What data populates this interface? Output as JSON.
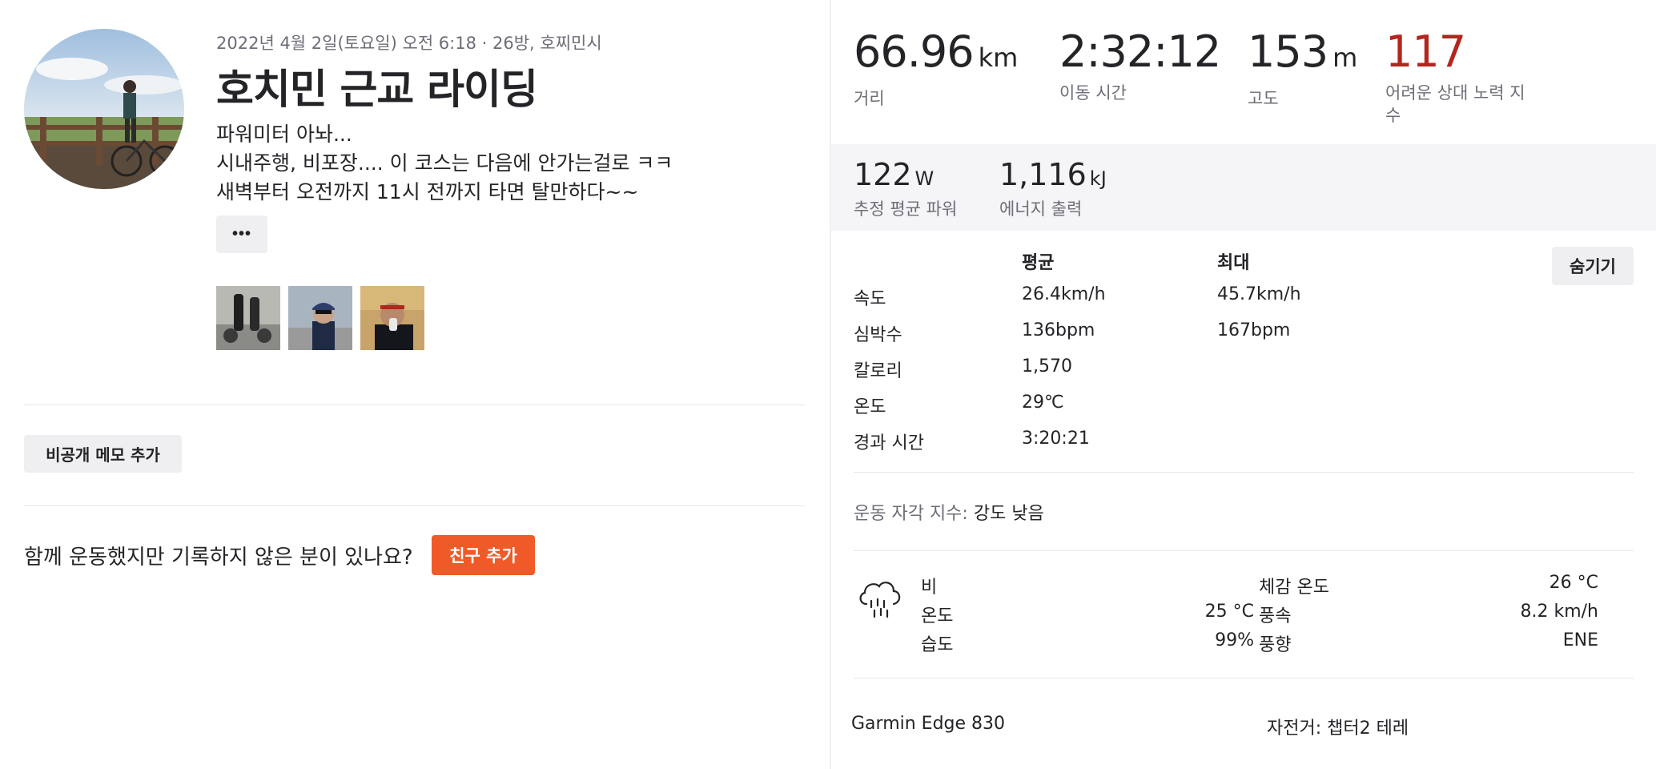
{
  "activity": {
    "meta": "2022년 4월 2일(토요일) 오전 6:18 · 26방, 호찌민시",
    "title": "호치민 근교 라이딩",
    "description": [
      "파워미터 아놔...",
      "시내주행, 비포장.... 이 코스는 다음에 안가는걸로 ㅋㅋ",
      "새벽부터 오전까지 11시 전까지 타면 탈만하다~~"
    ],
    "more_label": "•••",
    "photo_count": 3
  },
  "memo_button": "비공개 메모 추가",
  "invite": {
    "text": "함께 운동했지만 기록하지 않은 분이 있나요?",
    "button": "친구 추가"
  },
  "stats": [
    {
      "value": "66.96",
      "unit": "km",
      "label": "거리"
    },
    {
      "value": "2:32:12",
      "unit": "",
      "label": "이동 시간"
    },
    {
      "value": "153",
      "unit": "m",
      "label": "고도"
    },
    {
      "value": "117",
      "unit": "",
      "label": "어려운 상대 노력 지",
      "label2": "수"
    }
  ],
  "power": [
    {
      "value": "122",
      "unit": "W",
      "label": "추정 평균 파워"
    },
    {
      "value": "1,116",
      "unit": "kJ",
      "label": "에너지 출력"
    }
  ],
  "hide_button": "숨기기",
  "details": {
    "headers": [
      "",
      "평균",
      "최대"
    ],
    "rows": [
      [
        "속도",
        "26.4km/h",
        "45.7km/h"
      ],
      [
        "심박수",
        "136bpm",
        "167bpm"
      ],
      [
        "칼로리",
        "1,570",
        ""
      ],
      [
        "온도",
        "29℃",
        ""
      ],
      [
        "경과 시간",
        "3:20:21",
        ""
      ]
    ]
  },
  "rpe": {
    "label": "운동 자각 지수:",
    "value": "강도 낮음"
  },
  "weather": {
    "icon": "rain-cloud-icon",
    "condition": "비",
    "left": [
      {
        "label": "온도",
        "value": "25 °C"
      },
      {
        "label": "습도",
        "value": "99%"
      }
    ],
    "right": [
      {
        "label": "체감 온도",
        "value": "26 °C"
      },
      {
        "label": "풍속",
        "value": "8.2 km/h"
      },
      {
        "label": "풍향",
        "value": "ENE"
      }
    ]
  },
  "device": "Garmin Edge 830",
  "bike": "자전거: 챕터2 테레",
  "colors": {
    "accent": "#f05a28",
    "suffer": "#b3261e",
    "muted": "#6d6d78",
    "band": "#f5f5f7"
  }
}
